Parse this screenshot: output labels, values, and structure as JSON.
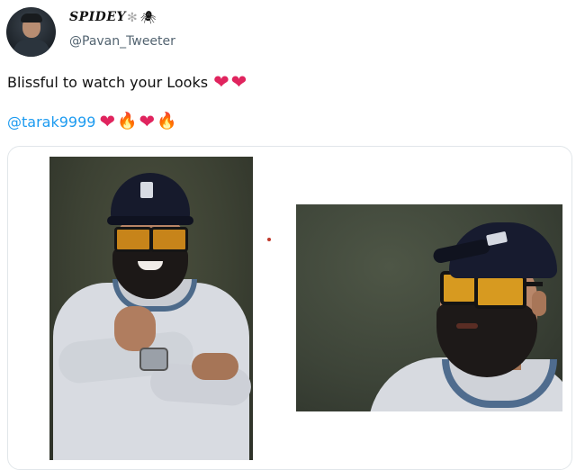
{
  "tweet": {
    "display_name": "SPIDEY",
    "name_icons": [
      "gear-icon",
      "spider-icon"
    ],
    "handle": "@Pavan_Tweeter",
    "text_line1": "Blissful to watch your Looks",
    "mention": "@tarak9999",
    "line1_emoji": [
      "heart-icon",
      "heart-icon"
    ],
    "line2_emoji": [
      "heart-icon",
      "fire-icon",
      "heart-icon",
      "fire-icon"
    ]
  },
  "colors": {
    "mention": "#1d9bf0",
    "heart": "#e0245e",
    "fire": "#f4a22a",
    "handle": "#536471"
  }
}
